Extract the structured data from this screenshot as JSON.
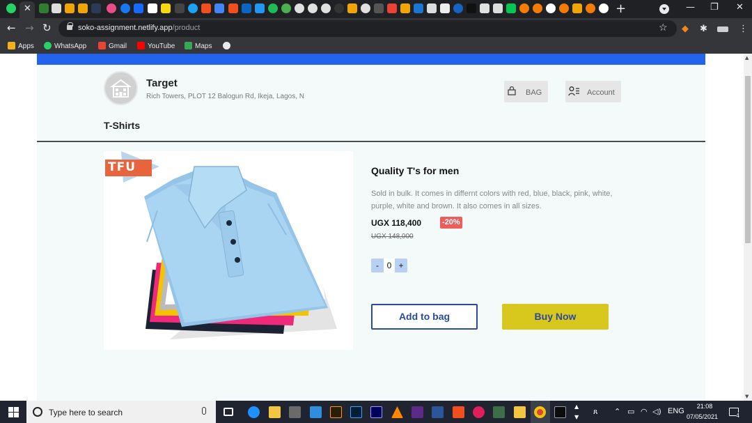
{
  "browser": {
    "tab_icon": "close-icon",
    "url_host": "soko-assignment.netlify.app",
    "url_path": "/product",
    "window_controls": [
      "minimize-icon",
      "restore-icon",
      "close-icon"
    ]
  },
  "bookmarks": [
    {
      "label": "Apps",
      "icon": "apps-grid-icon",
      "color": "#f2b01e"
    },
    {
      "label": "WhatsApp",
      "icon": "whatsapp-icon",
      "color": "#25d366"
    },
    {
      "label": "Gmail",
      "icon": "gmail-icon",
      "color": "#ea4335"
    },
    {
      "label": "YouTube",
      "icon": "youtube-icon",
      "color": "#ff0000"
    },
    {
      "label": "Maps",
      "icon": "maps-icon",
      "color": "#34a853"
    }
  ],
  "store": {
    "name": "Target",
    "address": "Rich Towers, PLOT 12 Balogun Rd, Ikeja, Lagos, N",
    "bag_label": "BAG",
    "account_label": "Account"
  },
  "section_title": "T-Shirts",
  "product": {
    "image_badge": "TFU",
    "title": "Quality T's for men",
    "description": "Sold in bulk. It comes in differnt colors with red, blue, black, pink, white, purple, white and brown. It also comes in all sizes.",
    "price": "UGX 118,400",
    "discount": "-20%",
    "old_price": "UGX 148,000",
    "quantity": "0",
    "qty_minus": "-",
    "qty_plus": "+",
    "add_to_bag_label": "Add to bag",
    "buy_now_label": "Buy Now"
  },
  "colors": {
    "accent_blue": "#2463eb",
    "buy_now_yellow": "#d8c81d",
    "discount_red": "#ee5c5c",
    "button_text_blue": "#2b4a9c"
  },
  "taskbar": {
    "search_placeholder": "Type here to search",
    "language": "ENG",
    "time": "21:08",
    "date": "07/05/2021",
    "notification_count": "4"
  }
}
